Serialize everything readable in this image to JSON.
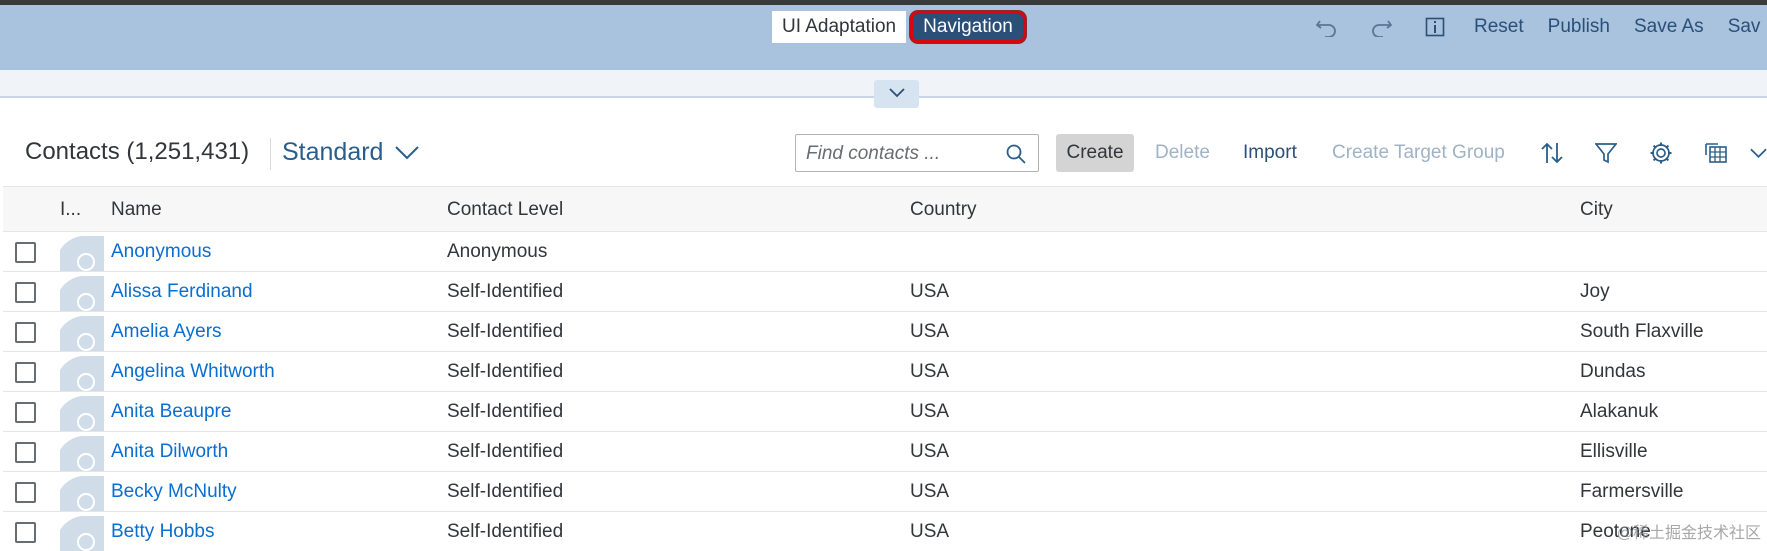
{
  "adaptation_bar": {
    "modes": [
      "UI Adaptation",
      "Navigation"
    ],
    "active_mode": "Navigation",
    "icons": [
      "undo-icon",
      "redo-icon",
      "info-icon"
    ],
    "actions": [
      "Reset",
      "Publish",
      "Save As",
      "Sav"
    ]
  },
  "toolbar": {
    "title": "Contacts (1,251,431)",
    "variant": "Standard",
    "search_placeholder": "Find contacts ...",
    "create_label": "Create",
    "delete_label": "Delete",
    "import_label": "Import",
    "create_target_group_label": "Create Target Group",
    "icons": [
      "sort-icon",
      "filter-icon",
      "settings-icon",
      "export-icon",
      "chevron-down-icon"
    ]
  },
  "table": {
    "columns": [
      "I...",
      "Name",
      "Contact Level",
      "Country",
      "City"
    ],
    "rows": [
      {
        "name": "Anonymous",
        "level": "Anonymous",
        "country": "",
        "city": ""
      },
      {
        "name": "Alissa Ferdinand",
        "level": "Self-Identified",
        "country": "USA",
        "city": "Joy"
      },
      {
        "name": "Amelia Ayers",
        "level": "Self-Identified",
        "country": "USA",
        "city": "South Flaxville"
      },
      {
        "name": "Angelina Whitworth",
        "level": "Self-Identified",
        "country": "USA",
        "city": "Dundas"
      },
      {
        "name": "Anita Beaupre",
        "level": "Self-Identified",
        "country": "USA",
        "city": "Alakanuk"
      },
      {
        "name": "Anita Dilworth",
        "level": "Self-Identified",
        "country": "USA",
        "city": "Ellisville"
      },
      {
        "name": "Becky McNulty",
        "level": "Self-Identified",
        "country": "USA",
        "city": "Farmersville"
      },
      {
        "name": "Betty Hobbs",
        "level": "Self-Identified",
        "country": "USA",
        "city": "Peotone"
      }
    ]
  },
  "watermark": "@稀土掘金技术社区",
  "colors": {
    "adaptation_bar": "#a9c2dd",
    "active_mode": "#2a4f78",
    "highlight_border": "#d6070f",
    "link": "#0a6ed1",
    "avatar": "#d0dce8"
  }
}
